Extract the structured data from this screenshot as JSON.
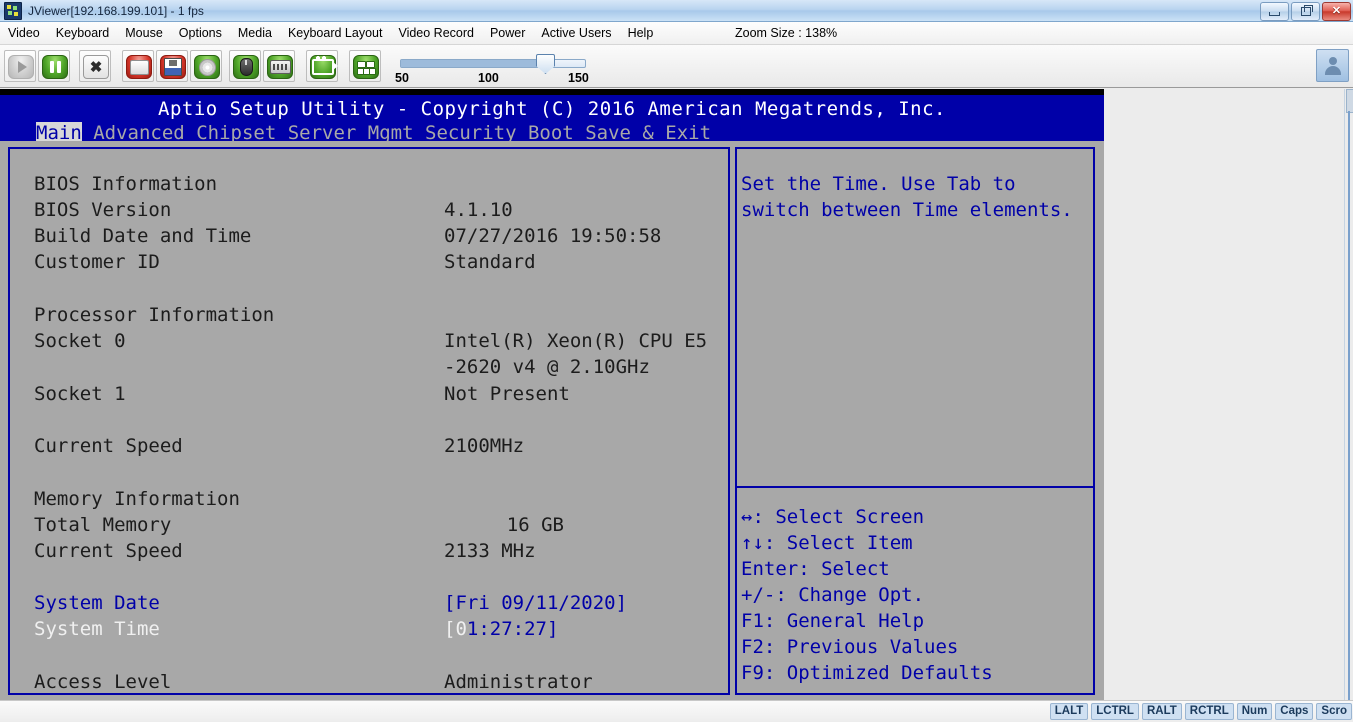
{
  "window": {
    "title": "JViewer[192.168.199.101] - 1 fps",
    "minimize_label": "",
    "restore_label": "",
    "close_label": "✕"
  },
  "menubar": {
    "items": [
      {
        "label": "Video"
      },
      {
        "label": "Keyboard"
      },
      {
        "label": "Mouse"
      },
      {
        "label": "Options"
      },
      {
        "label": "Media"
      },
      {
        "label": "Keyboard Layout"
      },
      {
        "label": "Video Record"
      },
      {
        "label": "Power"
      },
      {
        "label": "Active Users"
      },
      {
        "label": "Help"
      }
    ],
    "zoom_size": "Zoom Size : 138%"
  },
  "toolbar": {
    "buttons": [
      {
        "name": "play-button",
        "icon": "play-icon",
        "state": "disabled"
      },
      {
        "name": "pause-button",
        "icon": "pause-icon",
        "state": "enabled"
      },
      {
        "name": "fullscreen-button",
        "icon": "fullscreen-icon",
        "state": "enabled"
      },
      {
        "name": "virtual-drive-button",
        "icon": "hard-drive-icon",
        "state": "enabled"
      },
      {
        "name": "floppy-button",
        "icon": "floppy-disk-icon",
        "state": "enabled"
      },
      {
        "name": "cd-button",
        "icon": "cd-disc-icon",
        "state": "enabled"
      },
      {
        "name": "mouse-button",
        "icon": "mouse-icon",
        "state": "enabled"
      },
      {
        "name": "keyboard-button",
        "icon": "keyboard-icon",
        "state": "enabled"
      },
      {
        "name": "video-record-button",
        "icon": "video-camera-icon",
        "state": "enabled"
      },
      {
        "name": "hotkeys-button",
        "icon": "keys-grid-icon",
        "state": "enabled"
      }
    ],
    "zoom_slider": {
      "min_label": "50",
      "mid_label": "100",
      "max_label": "150",
      "value": 138
    },
    "user_button_icon": "user-icon"
  },
  "bios": {
    "title": "Aptio Setup Utility - Copyright (C) 2016 American Megatrends, Inc.",
    "tabs": [
      {
        "label": "Main",
        "active": true
      },
      {
        "label": "Advanced",
        "active": false
      },
      {
        "label": "Chipset",
        "active": false
      },
      {
        "label": "Server Mgmt",
        "active": false
      },
      {
        "label": "Security",
        "active": false
      },
      {
        "label": "Boot",
        "active": false
      },
      {
        "label": "Save & Exit",
        "active": false
      }
    ],
    "sections": {
      "bios_information_header": "BIOS Information",
      "bios_version_label": "BIOS Version",
      "bios_version_value": "4.1.10",
      "build_date_label": "Build Date and Time",
      "build_date_value": "07/27/2016 19:50:58",
      "customer_id_label": "Customer ID",
      "customer_id_value": "Standard",
      "processor_information_header": "Processor Information",
      "socket0_label": "Socket 0",
      "socket0_value_line1": "Intel(R) Xeon(R) CPU E5",
      "socket0_value_line2": "-2620 v4 @ 2.10GHz",
      "socket1_label": "Socket 1",
      "socket1_value": "Not Present",
      "cpu_current_speed_label": "Current Speed",
      "cpu_current_speed_value": "2100MHz",
      "memory_information_header": "Memory Information",
      "total_memory_label": "Total Memory",
      "total_memory_value": "16 GB",
      "mem_current_speed_label": "Current Speed",
      "mem_current_speed_value": "2133 MHz",
      "system_date_label": "System Date",
      "system_date_value": "[Fri 09/11/2020]",
      "system_time_label": "System Time",
      "system_time_cursor": "[0",
      "system_time_rest": "1:27:27]",
      "access_level_label": "Access Level",
      "access_level_value": "Administrator"
    },
    "help": {
      "text_line1": "Set the Time. Use Tab to",
      "text_line2": "switch between Time elements."
    },
    "keys": [
      {
        "glyph": "↔",
        "label": ": Select Screen"
      },
      {
        "glyph": "↑↓",
        "label": ": Select Item"
      },
      {
        "glyph": "",
        "label": "Enter: Select"
      },
      {
        "glyph": "",
        "label": "+/-: Change Opt."
      },
      {
        "glyph": "",
        "label": "F1: General Help"
      },
      {
        "glyph": "",
        "label": "F2: Previous Values"
      },
      {
        "glyph": "",
        "label": "F9: Optimized Defaults"
      }
    ]
  },
  "statusbar": {
    "indicators": [
      "LALT",
      "LCTRL",
      "RALT",
      "RCTRL",
      "Num",
      "Caps",
      "Scro"
    ]
  },
  "colors": {
    "bios_blue": "#0000a8",
    "bios_gray": "#a8a8a8",
    "title_blue": "#b9d4ef"
  }
}
